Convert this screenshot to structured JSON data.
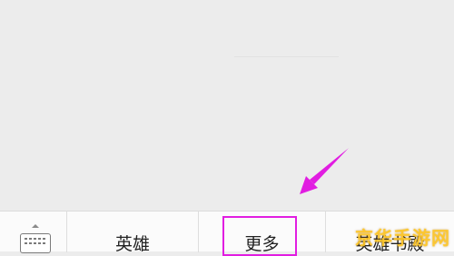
{
  "menu": {
    "items": [
      {
        "label": "英雄"
      },
      {
        "label": "更多"
      },
      {
        "label": "英雄书殿"
      }
    ]
  },
  "watermark": {
    "text": "京华手游网"
  },
  "colors": {
    "highlight": "#e11de1",
    "arrow": "#e11de1",
    "background": "#ececec",
    "menu_bg": "#fbfbfb"
  },
  "icons": {
    "keyboard_toggle": "keyboard-icon",
    "expand": "caret-up-icon"
  }
}
